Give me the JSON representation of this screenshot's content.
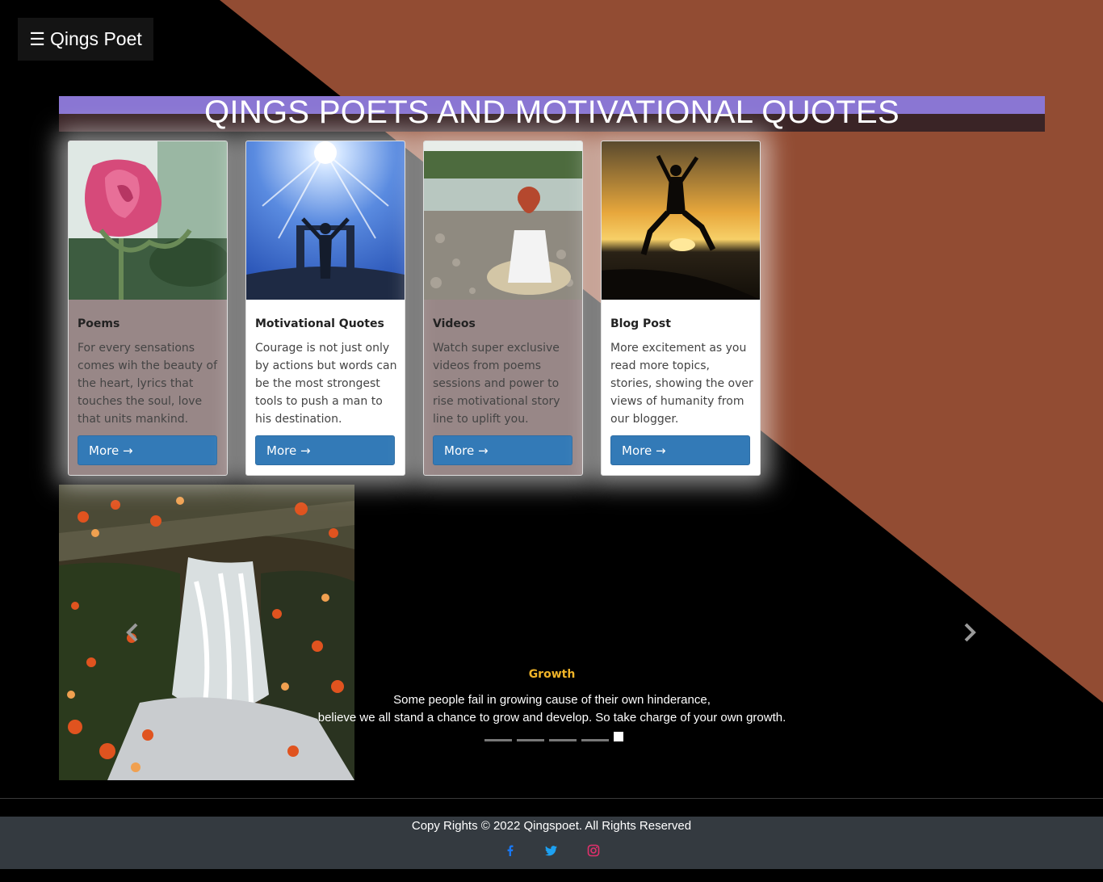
{
  "nav": {
    "brand": "Qings Poet",
    "menu_icon": "☰"
  },
  "banner": {
    "title": "QINGS POETS AND MOTIVATIONAL QUOTES"
  },
  "cards": [
    {
      "title": "Poems",
      "text": "For every sensations comes wih the beauty of the heart, lyrics that touches the soul, love that units mankind.",
      "button": "More →"
    },
    {
      "title": "Motivational Quotes",
      "text": "Courage is not just only by actions but words can be the most strongest tools to push a man to his destination.",
      "button": "More →"
    },
    {
      "title": "Videos",
      "text": "Watch super exclusive videos from poems sessions and power to rise motivational story line to uplift you.",
      "button": "More →"
    },
    {
      "title": "Blog Post",
      "text": "More excitement as you read more topics, stories, showing the over views of humanity from our blogger.",
      "button": "More →"
    }
  ],
  "carousel": {
    "caption_title": "Growth",
    "caption_line1": "Some people fail in growing cause of their own hinderance,",
    "caption_line2": "believe we all stand a chance to grow and develop. So take charge of your own growth.",
    "active_index": 4,
    "slide_count": 5
  },
  "footer": {
    "copyright": "Copy Rights © 2022 Qingspoet. All Rights Reserved"
  },
  "colors": {
    "background": "#000000",
    "diagonal": "#924c33",
    "banner_top": "#8a76d3",
    "banner_bottom": "#3a2426",
    "button": "#337ab7",
    "caption_title": "#f0b428",
    "footer": "#343a40",
    "facebook": "#1877f2",
    "twitter": "#1da1f2",
    "instagram": "#e1306c"
  },
  "icons": [
    "menu-icon",
    "chevron-left-icon",
    "chevron-right-icon",
    "facebook-icon",
    "twitter-icon",
    "instagram-icon"
  ]
}
